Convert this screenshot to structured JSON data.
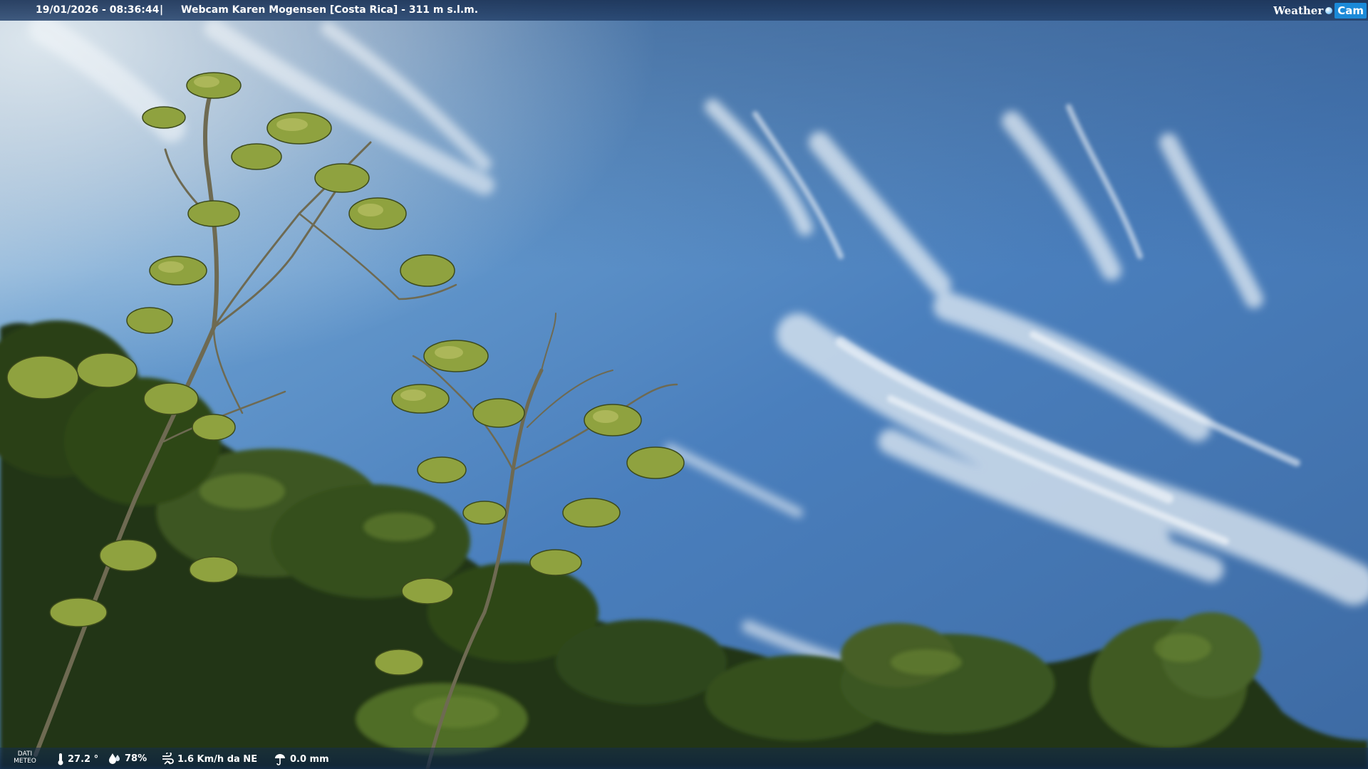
{
  "header": {
    "timestamp": "19/01/2026 - 08:36:44",
    "separator": "|",
    "title": "Webcam Karen Mogensen [Costa Rica]  - 311 m s.l.m."
  },
  "logo": {
    "word": "Weather",
    "cam": "Cam"
  },
  "weather_bar": {
    "dati_line1": "DATI",
    "dati_line2": "METEO",
    "temperature": "27.2 °",
    "humidity": "78%",
    "wind": "1.6 Km/h da NE",
    "rain": "0.0 mm"
  },
  "icons": {
    "temperature": "thermometer-icon",
    "humidity": "humidity-drop-icon",
    "wind": "wind-icon",
    "rain": "rain-icon"
  },
  "colors": {
    "sky_top": "#34598f",
    "sky_mid": "#4f86c4",
    "sky_bright": "#c9ddeb",
    "foliage_dark": "#1f3315",
    "foliage_light": "#9fb04a",
    "brand_blue": "#1b8ad8"
  }
}
